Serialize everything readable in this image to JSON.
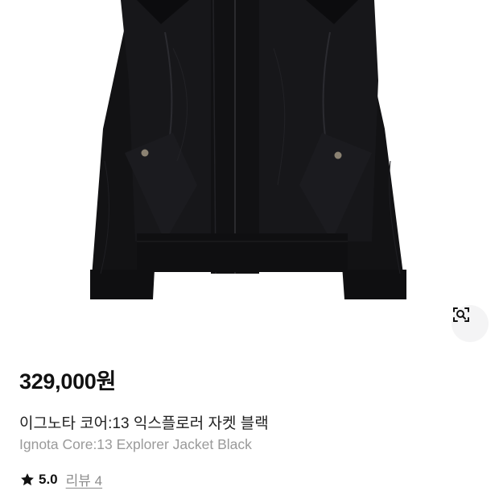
{
  "product": {
    "price": "329,000원",
    "title_ko": "이그노타 코어:13 익스플로러 자켓 블랙",
    "title_en": "Ignota Core:13 Explorer Jacket Black",
    "rating": "5.0",
    "review_label": "리뷰 4"
  },
  "icons": {
    "lens": "lens-search-icon",
    "star": "star-icon"
  },
  "colors": {
    "jacket": "#141416",
    "accent_text": "#111111",
    "muted_text": "#9a9a9a"
  }
}
